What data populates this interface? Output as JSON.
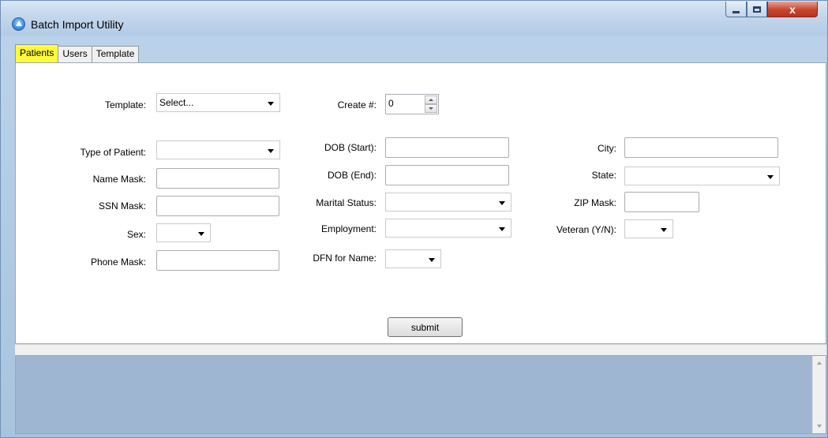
{
  "window": {
    "title": "Batch Import Utility",
    "minimize": "minimize",
    "maximize": "maximize",
    "close": "x"
  },
  "tabs": [
    {
      "label": "Patients",
      "active": true
    },
    {
      "label": "Users",
      "active": false
    },
    {
      "label": "Template",
      "active": false
    }
  ],
  "form": {
    "template": {
      "label": "Template:",
      "value": "Select..."
    },
    "create_count": {
      "label": "Create #:",
      "value": "0"
    },
    "type_of_patient": {
      "label": "Type of Patient:",
      "value": ""
    },
    "name_mask": {
      "label": "Name Mask:",
      "value": ""
    },
    "ssn_mask": {
      "label": "SSN Mask:",
      "value": ""
    },
    "sex": {
      "label": "Sex:",
      "value": ""
    },
    "phone_mask": {
      "label": "Phone Mask:",
      "value": ""
    },
    "dob_start": {
      "label": "DOB (Start):",
      "value": ""
    },
    "dob_end": {
      "label": "DOB (End):",
      "value": ""
    },
    "marital_status": {
      "label": "Marital Status:",
      "value": ""
    },
    "employment": {
      "label": "Employment:",
      "value": ""
    },
    "dfn_for_name": {
      "label": "DFN for Name:",
      "value": ""
    },
    "city": {
      "label": "City:",
      "value": ""
    },
    "state": {
      "label": "State:",
      "value": ""
    },
    "zip_mask": {
      "label": "ZIP Mask:",
      "value": ""
    },
    "veteran": {
      "label": "Veteran (Y/N):",
      "value": ""
    },
    "submit_label": "submit"
  },
  "colors": {
    "active_tab": "#fffb3c",
    "log_background": "#9fb6d2"
  }
}
